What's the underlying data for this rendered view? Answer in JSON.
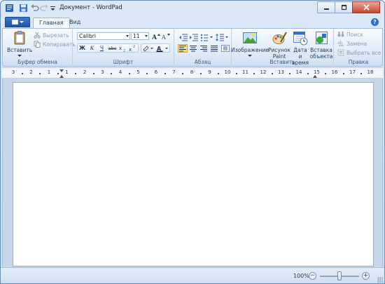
{
  "window": {
    "title": "Документ - WordPad"
  },
  "tabs": {
    "home": "Главная",
    "view": "Вид"
  },
  "ribbon": {
    "clipboard": {
      "label": "Буфер обмена",
      "paste": "Вставить",
      "cut": "Вырезать",
      "copy": "Копировать"
    },
    "font": {
      "label": "Шрифт",
      "family": "Calibri",
      "size": "11"
    },
    "paragraph": {
      "label": "Абзац"
    },
    "insert": {
      "label": "Вставить",
      "picture": "Изображение",
      "paint_line1": "Рисунок",
      "paint_line2": "Paint",
      "datetime_line1": "Дата и",
      "datetime_line2": "время",
      "object_line1": "Вставка",
      "object_line2": "объекта"
    },
    "editing": {
      "label": "Правка",
      "find": "Поиск",
      "replace": "Замена",
      "select_all": "Выбрать все"
    }
  },
  "ruler": {
    "numbers": [
      "3",
      "2",
      "1",
      "1",
      "2",
      "3",
      "4",
      "5",
      "6",
      "7",
      "8",
      "9",
      "10",
      "11",
      "12",
      "13",
      "14",
      "15",
      "16",
      "17",
      "18"
    ]
  },
  "status": {
    "zoom": "100%"
  },
  "colors": {
    "accent": "#1f57a6",
    "ribbon_bg": "#dde9f7",
    "close_button": "#c8452f"
  }
}
